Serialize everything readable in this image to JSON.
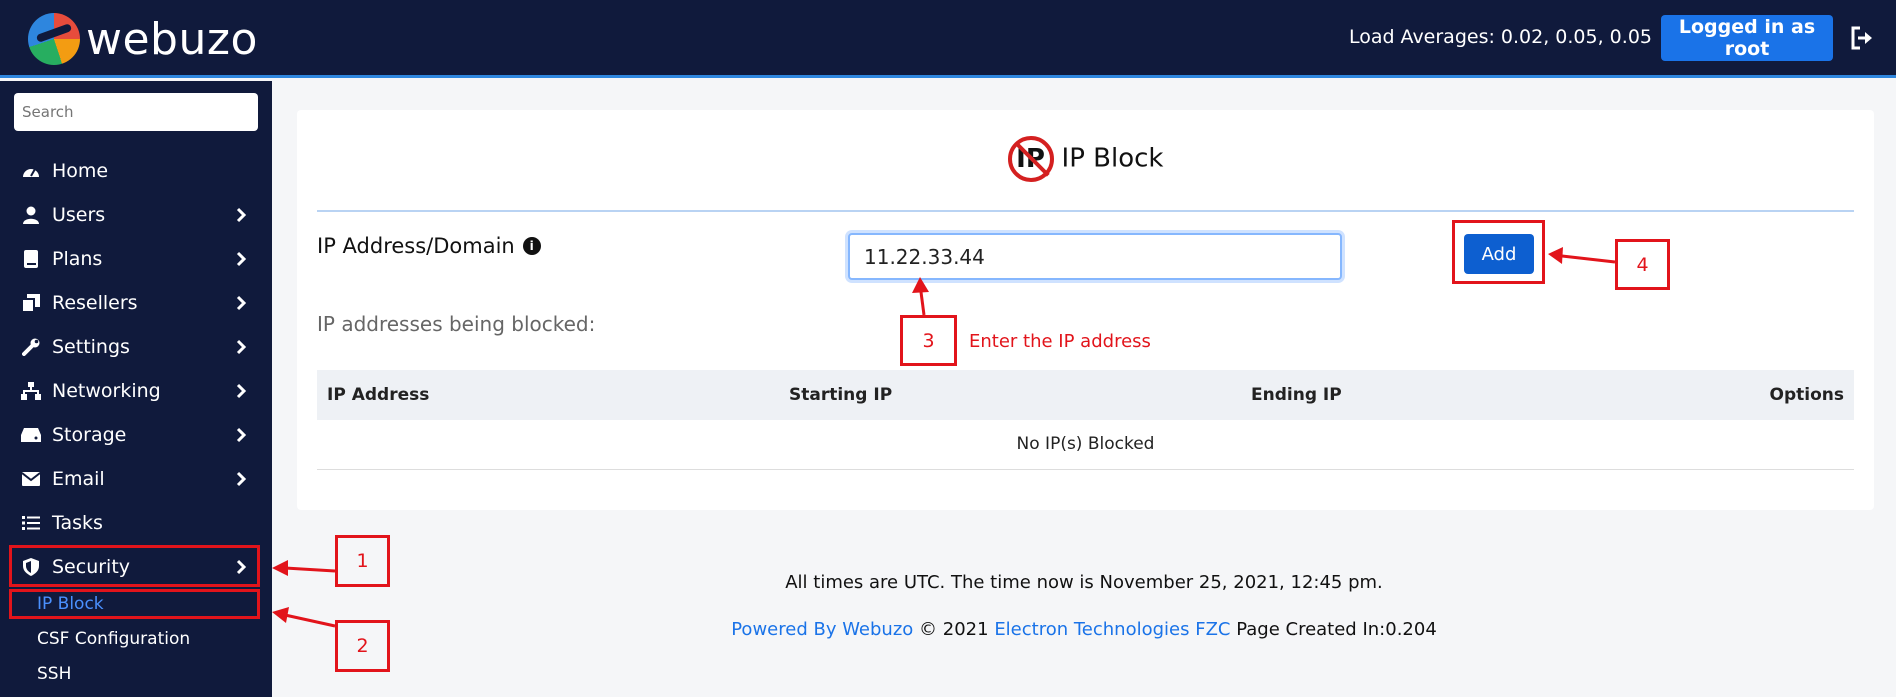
{
  "header": {
    "logo_text": "webuzo",
    "load_averages": "Load Averages: 0.02, 0.05, 0.05",
    "logged_in_label": "Logged in as root",
    "brand_color": "#101a3c",
    "accent_color": "#1a73e8"
  },
  "sidebar": {
    "search_placeholder": "Search",
    "items": [
      {
        "label": "Home",
        "icon": "dashboard-icon",
        "has_submenu": false
      },
      {
        "label": "Users",
        "icon": "user-icon",
        "has_submenu": true
      },
      {
        "label": "Plans",
        "icon": "book-icon",
        "has_submenu": true
      },
      {
        "label": "Resellers",
        "icon": "copy-icon",
        "has_submenu": true
      },
      {
        "label": "Settings",
        "icon": "wrench-icon",
        "has_submenu": true
      },
      {
        "label": "Networking",
        "icon": "network-icon",
        "has_submenu": true
      },
      {
        "label": "Storage",
        "icon": "hdd-icon",
        "has_submenu": true
      },
      {
        "label": "Email",
        "icon": "envelope-icon",
        "has_submenu": true
      },
      {
        "label": "Tasks",
        "icon": "list-icon",
        "has_submenu": false
      },
      {
        "label": "Security",
        "icon": "shield-icon",
        "has_submenu": true
      }
    ],
    "security_subitems": [
      {
        "label": "IP Block",
        "active": true
      },
      {
        "label": "CSF Configuration",
        "active": false
      },
      {
        "label": "SSH",
        "active": false
      }
    ]
  },
  "main": {
    "title": "IP Block",
    "title_icon_text": "IP",
    "field_label": "IP Address/Domain",
    "ip_value": "11.22.33.44",
    "add_label": "Add",
    "blocked_heading": "IP addresses being blocked:",
    "table": {
      "columns": [
        "IP Address",
        "Starting IP",
        "Ending IP",
        "Options"
      ],
      "empty_message": "No IP(s) Blocked"
    }
  },
  "footer": {
    "time_text": "All times are UTC. The time now is November 25, 2021, 12:45 pm.",
    "powered_by": "Powered By Webuzo",
    "copyright": "© 2021",
    "company": "Electron Technologies FZC",
    "page_created": "Page Created In:0.204"
  },
  "annotations": {
    "one": "1",
    "two": "2",
    "three": "3",
    "four": "4",
    "hint": "Enter the IP address",
    "color": "#e2141b"
  }
}
